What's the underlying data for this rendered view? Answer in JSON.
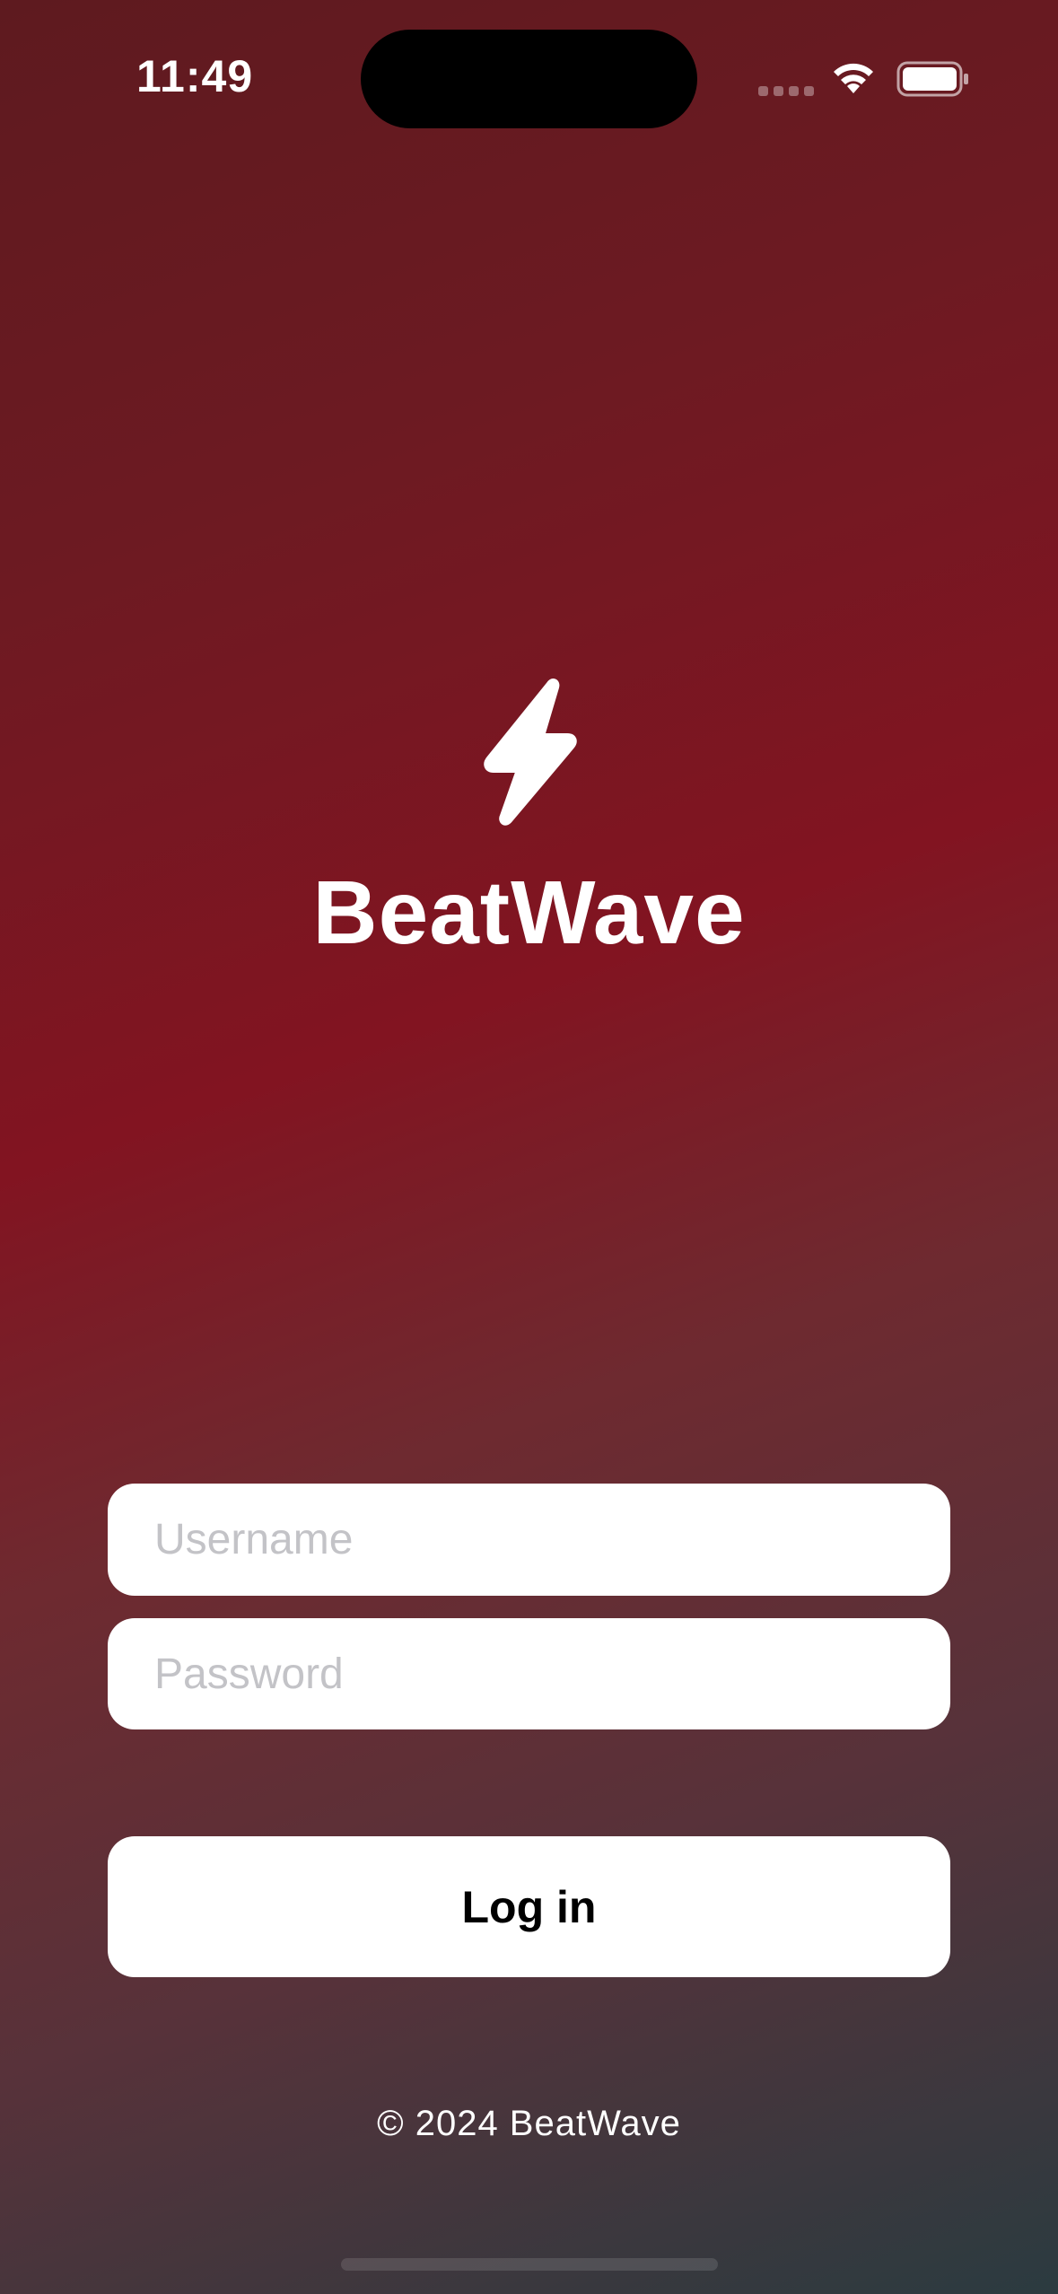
{
  "status_bar": {
    "time": "11:49",
    "icons": [
      "signal-icon",
      "wifi-icon",
      "battery-icon"
    ]
  },
  "app": {
    "logo_icon": "lightning-bolt-icon",
    "title": "BeatWave"
  },
  "form": {
    "username_placeholder": "Username",
    "username_value": "",
    "password_placeholder": "Password",
    "password_value": "",
    "login_label": "Log in"
  },
  "footer": {
    "copyright": "© 2024 BeatWave"
  },
  "colors": {
    "background_top": "#5e1a1f",
    "background_mid": "#821421",
    "background_bottom": "#2b3b40",
    "field_bg": "#ffffff",
    "placeholder": "#c3c3c7"
  }
}
